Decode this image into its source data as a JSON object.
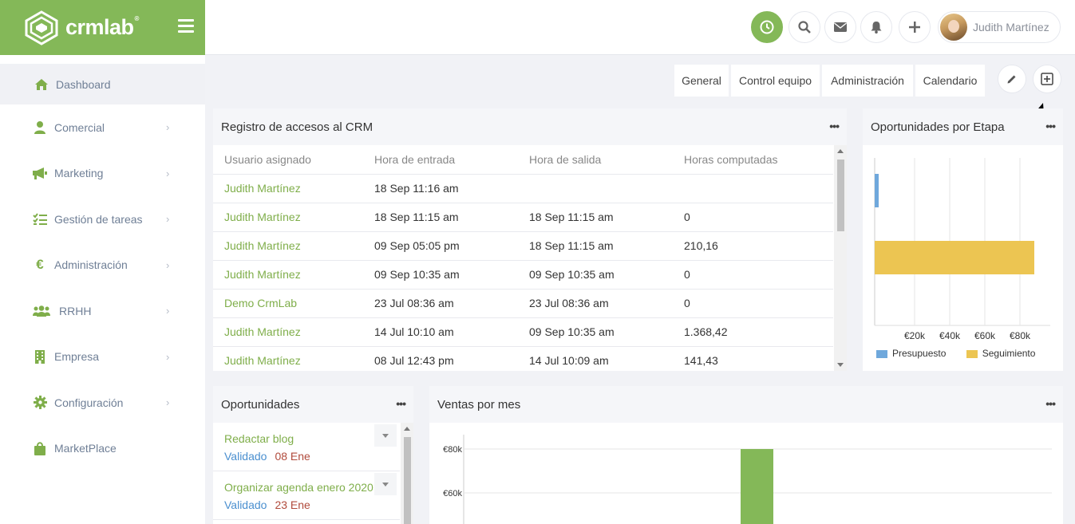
{
  "brand": {
    "name": "crmlab",
    "mark": "®",
    "color": "#84b858"
  },
  "sidebar": {
    "items": [
      {
        "label": "Dashboard",
        "icon": "home-icon",
        "active": true
      },
      {
        "label": "Comercial",
        "icon": "user-icon"
      },
      {
        "label": "Marketing",
        "icon": "megaphone-icon"
      },
      {
        "label": "Gestión de tareas",
        "icon": "checklist-icon"
      },
      {
        "label": "Administración",
        "icon": "euro-icon"
      },
      {
        "label": "RRHH",
        "icon": "users-icon"
      },
      {
        "label": "Empresa",
        "icon": "building-icon"
      },
      {
        "label": "Configuración",
        "icon": "gear-icon"
      },
      {
        "label": "MarketPlace",
        "icon": "bag-icon"
      }
    ]
  },
  "header": {
    "user_name": "Judith Martínez"
  },
  "tabs": [
    "General",
    "Control equipo",
    "Administración",
    "Calendario"
  ],
  "access_log": {
    "title": "Registro de accesos al CRM",
    "columns": [
      "Usuario asignado",
      "Hora de entrada",
      "Hora de salida",
      "Horas computadas"
    ],
    "rows": [
      [
        "Judith Martínez",
        "18 Sep 11:16 am",
        "",
        ""
      ],
      [
        "Judith Martínez",
        "18 Sep 11:15 am",
        "18 Sep 11:15 am",
        "0"
      ],
      [
        "Judith Martínez",
        "09 Sep 05:05 pm",
        "18 Sep 11:15 am",
        "210,16"
      ],
      [
        "Judith Martínez",
        "09 Sep 10:35 am",
        "09 Sep 10:35 am",
        "0"
      ],
      [
        "Demo CrmLab",
        "23 Jul 08:36 am",
        "23 Jul 08:36 am",
        "0"
      ],
      [
        "Judith Martínez",
        "14 Jul 10:10 am",
        "09 Sep 10:35 am",
        "1.368,42"
      ],
      [
        "Judith Martínez",
        "08 Jul 12:43 pm",
        "14 Jul 10:09 am",
        "141,43"
      ]
    ]
  },
  "stage_chart": {
    "title": "Oportunidades por Etapa",
    "chart_data": {
      "type": "bar",
      "orientation": "horizontal",
      "categories": [
        "",
        ""
      ],
      "series": [
        {
          "name": "Presupuesto",
          "values": [
            2000,
            0
          ],
          "color": "#6fa8dc"
        },
        {
          "name": "Seguimiento",
          "values": [
            0,
            85000
          ],
          "color": "#ecc552"
        }
      ],
      "xticks": [
        "€20k",
        "€40k",
        "€60k",
        "€80k"
      ],
      "xlim": [
        0,
        90000
      ],
      "legend": "bottom"
    }
  },
  "opportunities": {
    "title": "Oportunidades",
    "items": [
      {
        "title": "Redactar blog",
        "status": "Validado",
        "date": "08 Ene"
      },
      {
        "title": "Organizar agenda enero 2020",
        "status": "Validado",
        "date": "23 Ene"
      }
    ]
  },
  "sales_chart": {
    "title": "Ventas por mes",
    "chart_data": {
      "type": "bar",
      "categories": [
        ""
      ],
      "values": [
        80000
      ],
      "yticks": [
        "€80k",
        "€60k"
      ],
      "color": "#84b858"
    }
  }
}
